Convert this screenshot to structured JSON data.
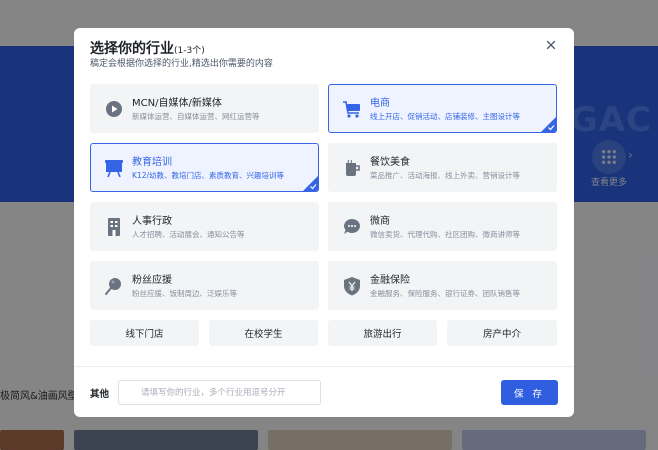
{
  "background": {
    "banner_text": "GAC",
    "more_label": "查看更多",
    "section_label": "极简风&油画风壁纸"
  },
  "modal": {
    "title": "选择你的行业",
    "title_hint": "(1-3个)",
    "subtitle": "稿定会根据你选择的行业,精选出你需要的内容",
    "industries": [
      {
        "title": "MCN/自媒体/新媒体",
        "desc": "新媒体运营、自媒体运营、网红运营等",
        "icon": "play-video-icon",
        "selected": false
      },
      {
        "title": "电商",
        "desc": "线上开店、促销活动、店铺装修、主图设计等",
        "icon": "shopping-cart-icon",
        "selected": true
      },
      {
        "title": "教育培训",
        "desc": "K12/幼教、教培门店、素质教育、兴趣培训等",
        "icon": "blackboard-icon",
        "selected": true
      },
      {
        "title": "餐饮美食",
        "desc": "菜品推广、活动海报、线上外卖、营销设计等",
        "icon": "food-cup-icon",
        "selected": false
      },
      {
        "title": "人事行政",
        "desc": "人才招聘、活动展会、通知公告等",
        "icon": "office-building-icon",
        "selected": false
      },
      {
        "title": "微商",
        "desc": "微信卖货、代理代购、社区团购、微商讲师等",
        "icon": "chat-bubble-icon",
        "selected": false
      },
      {
        "title": "粉丝应援",
        "desc": "粉丝应援、饭制周边、泛娱乐等",
        "icon": "lollipop-icon",
        "selected": false
      },
      {
        "title": "金融保险",
        "desc": "金融服务、保险服务、银行证券、团队销售等",
        "icon": "yen-shield-icon",
        "selected": false
      }
    ],
    "chips": [
      "线下门店",
      "在校学生",
      "旅游出行",
      "房产中介"
    ],
    "other_label": "其他",
    "other_placeholder": "请填写你的行业，多个行业用逗号分开",
    "save_label": "保 存"
  },
  "colors": {
    "accent": "#2f5fe0",
    "selected_border": "#3565e6",
    "selected_bg": "#eef3ff",
    "card_bg": "#f3f4f6"
  }
}
